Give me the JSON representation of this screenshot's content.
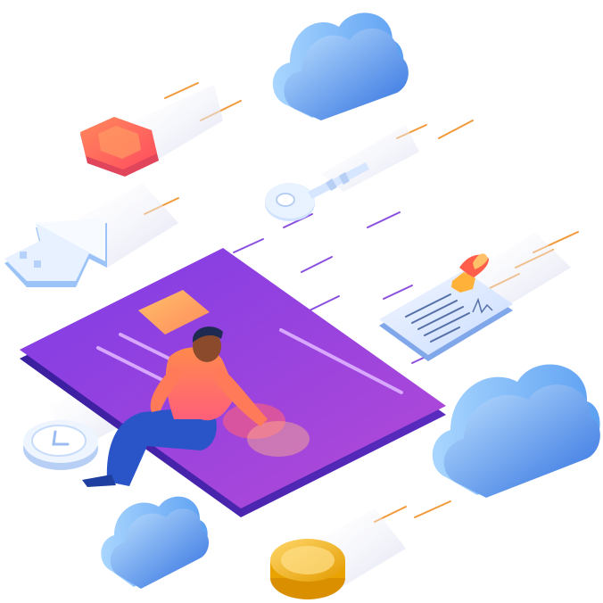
{
  "illustration": {
    "palette": {
      "card_top": "#7b3fe4",
      "card_bottom": "#4a2ab8",
      "card_chip": "#f7a35c",
      "cloud_light": "#9fd3ff",
      "cloud_dark": "#2f6fe0",
      "coin": "#f4b400",
      "shield": "#ff6b4a",
      "person_shirt": "#ff7a59",
      "person_pants": "#2a55c8",
      "speed_lines": "#f29a3a",
      "speed_lines_alt": "#8a4fe0"
    },
    "icons": [
      "credit-card-icon",
      "person-icon",
      "cloud-icon",
      "key-icon",
      "coin-icon",
      "hexagon-shield-icon",
      "contract-document-icon",
      "upload-arrow-icon",
      "clock-icon",
      "fire-seal-icon"
    ]
  }
}
